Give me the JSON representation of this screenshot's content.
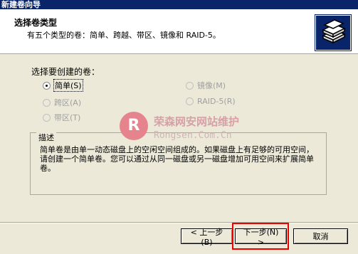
{
  "window": {
    "title": "新建卷向导"
  },
  "header": {
    "title": "选择卷类型",
    "subtitle": "有五个类型的卷：简单、跨越、带区、镜像和 RAID-5。",
    "icon": "disk-stack-icon"
  },
  "form": {
    "prompt": "选择要创建的卷：",
    "options": [
      {
        "label": "简单(S)",
        "checked": true,
        "enabled": true
      },
      {
        "label": "跨区(A)",
        "checked": false,
        "enabled": false
      },
      {
        "label": "带区(T)",
        "checked": false,
        "enabled": false
      },
      {
        "label": "镜像(M)",
        "checked": false,
        "enabled": false
      },
      {
        "label": "RAID-5(R)",
        "checked": false,
        "enabled": false
      }
    ]
  },
  "description": {
    "legend": "描述",
    "text": "简单卷是由单一动态磁盘上的空闲空间组成的。如果磁盘上有足够的可用空间，请创建一个简单卷。您可以通过从同一磁盘或另一磁盘增加可用空间来扩展简单卷。"
  },
  "buttons": {
    "back": "< 上一步(B)",
    "next": "下一步(N) >",
    "cancel": "取消"
  },
  "watermark": {
    "logo": "R",
    "cn": "荣森网安网站维护",
    "en": "Rongsen.Com.Cn"
  },
  "colors": {
    "title_bar": "#0a246a",
    "dialog_bg": "#ece9d8",
    "highlight": "#e00000"
  }
}
